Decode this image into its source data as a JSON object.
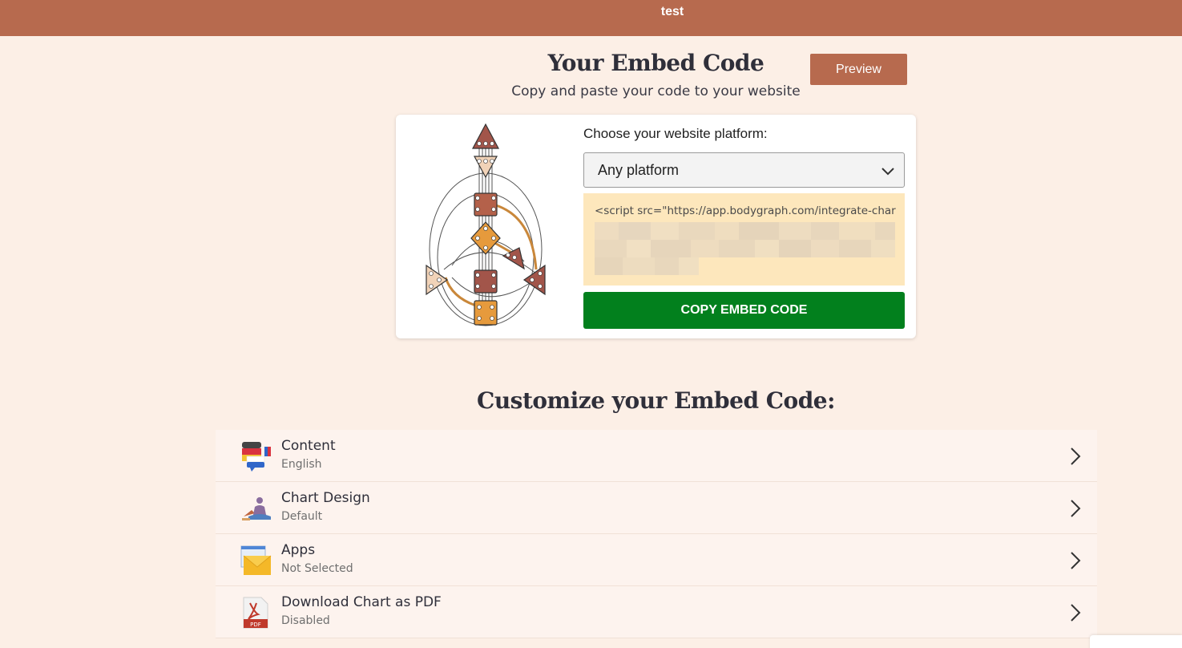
{
  "topbar": {
    "title": "test"
  },
  "header": {
    "title": "Your Embed Code",
    "subtitle": "Copy and paste your code to your website",
    "preview_label": "Preview"
  },
  "embed": {
    "platform_label": "Choose your website platform:",
    "platform_selected": "Any platform",
    "code_visible": "<script src=\"https://app.bodygraph.com/integrate-char",
    "copy_label": "COPY EMBED CODE"
  },
  "customize": {
    "heading": "Customize your Embed Code:",
    "items": [
      {
        "title": "Content",
        "value": "English",
        "icon": "language-flags-icon"
      },
      {
        "title": "Chart Design",
        "value": "Default",
        "icon": "chart-design-icon"
      },
      {
        "title": "Apps",
        "value": "Not Selected",
        "icon": "apps-envelope-icon"
      },
      {
        "title": "Download Chart as PDF",
        "value": "Disabled",
        "icon": "pdf-icon"
      }
    ]
  },
  "colors": {
    "topbar": "#b76a4e",
    "background": "#fcefe6",
    "copy_button": "#02801d",
    "code_box": "#fde7bc"
  }
}
